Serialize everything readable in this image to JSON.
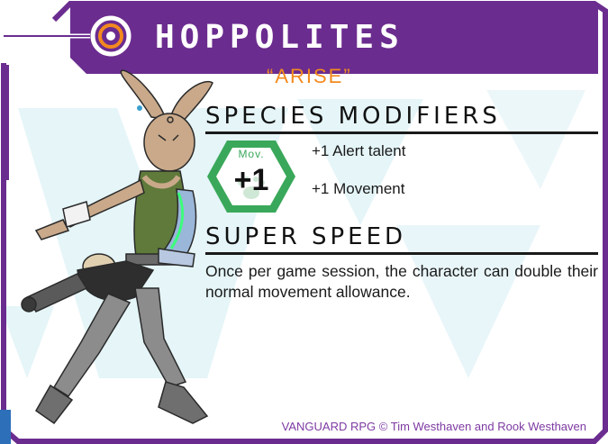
{
  "card": {
    "title": "HOPPOLITES",
    "subtitle": "“ARISE”",
    "colors": {
      "frame": "#6b2c8f",
      "accent_orange": "#f28a1e",
      "watermark": "#dff2f6",
      "badge_green": "#3aa85a"
    },
    "icons": [
      "target-ring-icon",
      "paw-print-icon"
    ]
  },
  "species_modifiers": {
    "heading": "SPECIES MODIFIERS",
    "badge": {
      "label": "Mov.",
      "value": "+1"
    },
    "items": [
      "+1 Alert talent",
      "+1 Movement"
    ]
  },
  "ability": {
    "heading": "SUPER SPEED",
    "description": "Once per game session, the character can double their normal movement allowance."
  },
  "footer": {
    "credit": "VANGUARD RPG © Tim Westhaven and Rook Westhaven"
  }
}
